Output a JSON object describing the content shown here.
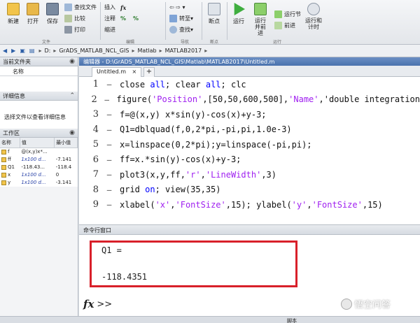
{
  "toolstrip": {
    "new": "新建",
    "open": "打开",
    "save": "保存",
    "find_file": "查找文件",
    "compare": "比较",
    "print": "打印",
    "insert": "插入",
    "comment": "注释",
    "indent": "缩进",
    "goto": "转至",
    "find": "查找",
    "breakpoint": "断点",
    "run": "运行",
    "run_advance": "运行并前进",
    "run_section": "运行节",
    "advance": "前进",
    "run_time": "运行和计时",
    "group_file": "文件",
    "group_edit": "编辑",
    "group_nav": "导航",
    "group_bp": "断点",
    "group_run": "运行"
  },
  "address": {
    "drive": "D:",
    "parts": [
      "GrADS_MATLAB_NCL_GIS",
      "Matlab",
      "MATLAB2017"
    ]
  },
  "left": {
    "current_folder": "当前文件夹",
    "name_col": "名称",
    "details_title": "详细信息",
    "details_text": "选择文件以查看详细信息",
    "workspace": "工作区",
    "ws_cols": [
      "名称",
      "值",
      "最小值"
    ],
    "vars": [
      {
        "name": "f",
        "value": "@(x,y)x*...",
        "min": ""
      },
      {
        "name": "ff",
        "value": "1x100 d...",
        "min": "-7.141"
      },
      {
        "name": "Q1",
        "value": "-118.43...",
        "min": "-118.4"
      },
      {
        "name": "x",
        "value": "1x100 d...",
        "min": "0"
      },
      {
        "name": "y",
        "value": "1x100 d...",
        "min": "-3.141"
      }
    ]
  },
  "editor": {
    "title": "编辑器 - D:\\GrADS_MATLAB_NCL_GIS\\Matlab\\MATLAB2017\\Untitled.m",
    "tab": "Untitled.m",
    "lines": [
      {
        "n": "1",
        "t": "close all; clear all; clc"
      },
      {
        "n": "2",
        "t": "figure('Position',[50,50,600,500],'Name','double integration"
      },
      {
        "n": "3",
        "t": "f=@(x,y) x*sin(y)-cos(x)+y-3;"
      },
      {
        "n": "4",
        "t": "Q1=dblquad(f,0,2*pi,-pi,pi,1.0e-3)"
      },
      {
        "n": "5",
        "t": "x=linspace(0,2*pi);y=linspace(-pi,pi);"
      },
      {
        "n": "6",
        "t": "ff=x.*sin(y)-cos(x)+y-3;"
      },
      {
        "n": "7",
        "t": "plot3(x,y,ff,'r','LineWidth',3)"
      },
      {
        "n": "8",
        "t": "grid on; view(35,35)"
      },
      {
        "n": "9",
        "t": "xlabel('x','FontSize',15); ylabel('y','FontSize',15)"
      }
    ]
  },
  "command": {
    "title": "命令行窗口",
    "out_label": "Q1 =",
    "out_value": "-118.4351",
    "prompt": ">>"
  },
  "status": {
    "script": "脚本"
  },
  "watermark": "悟空问答",
  "colors": {
    "highlight_box": "#d8202a",
    "string": "#a020f0",
    "keyword": "#0000ff"
  }
}
